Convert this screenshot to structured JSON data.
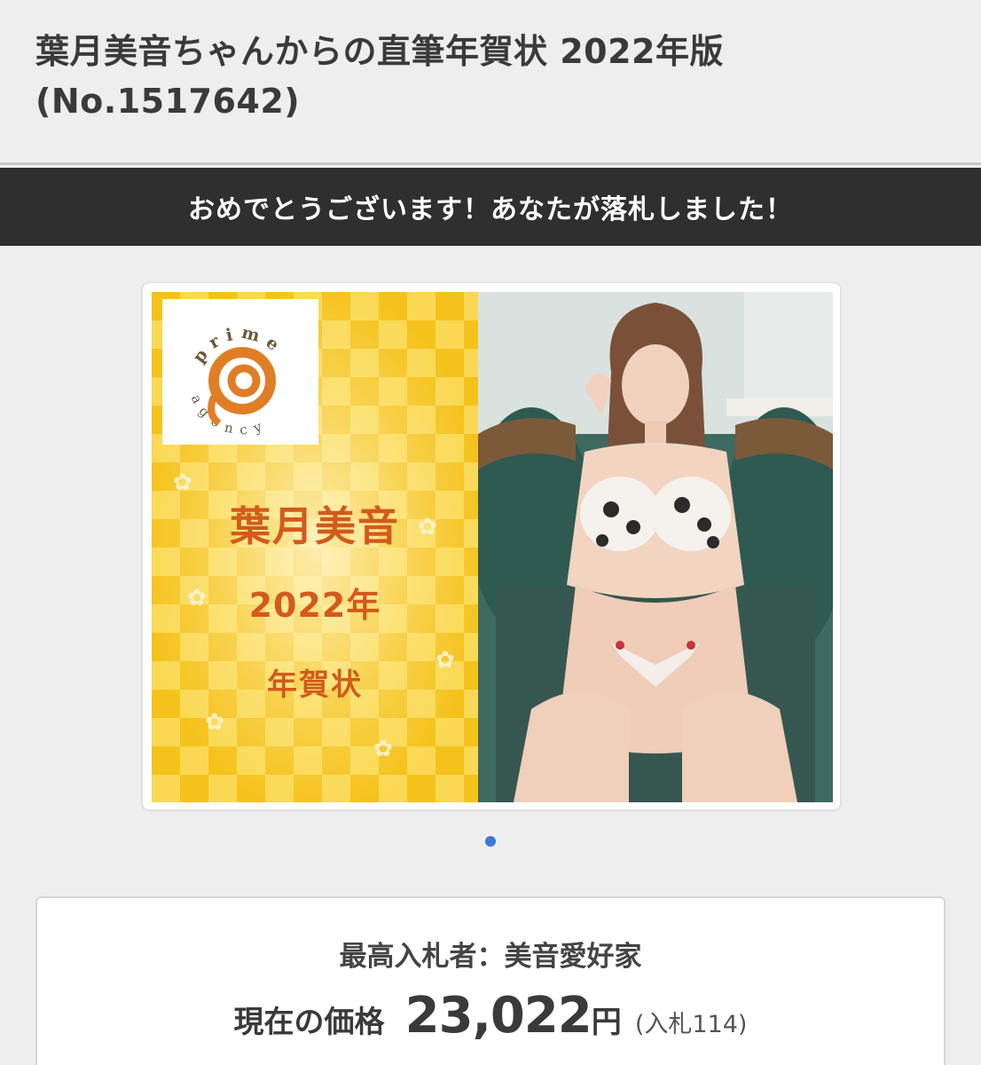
{
  "item": {
    "title": "葉月美音ちゃんからの直筆年賀状 2022年版",
    "number": "(No.1517642)"
  },
  "banner": {
    "message": "おめでとうございます！あなたが落札しました！"
  },
  "card": {
    "logo_word_top": "prime",
    "logo_word_bottom": "agency",
    "name": "葉月美音",
    "year": "2022年",
    "greeting": "年賀状"
  },
  "carousel": {
    "page_count": 1,
    "active_index": 0
  },
  "bid_info": {
    "bidder_label": "最高入札者：",
    "bidder_name": "美音愛好家",
    "price_label": "現在の価格",
    "price_value": "23,022",
    "price_unit": "円",
    "bid_count": "(入札114)"
  },
  "colors": {
    "banner_bg": "#2f2f2f",
    "card_gold": "#f5c21b",
    "card_text": "#d25a1c",
    "dot_active": "#3a7bd5"
  }
}
